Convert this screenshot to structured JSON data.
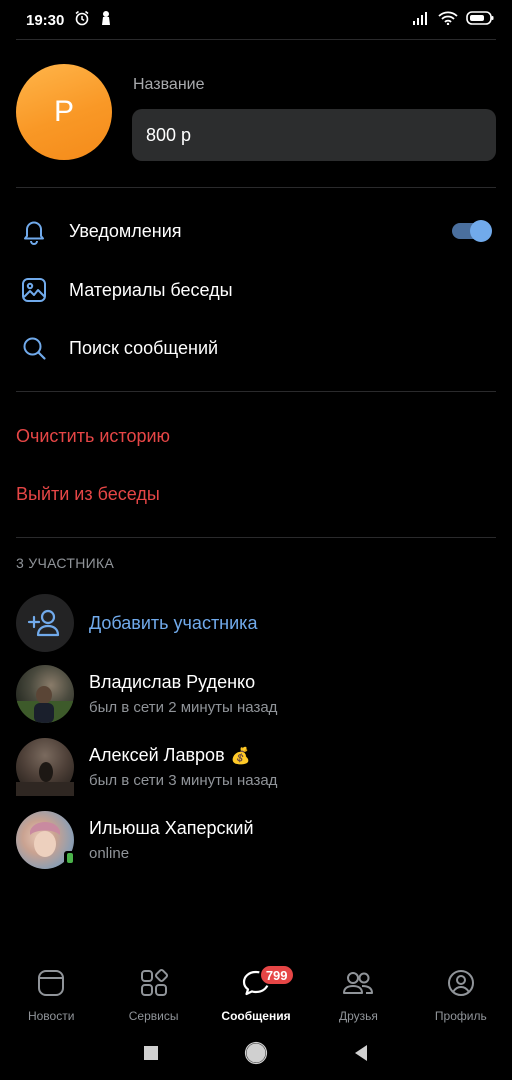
{
  "status_bar": {
    "time": "19:30"
  },
  "chat": {
    "avatar_letter": "Р",
    "name_label": "Название",
    "name_value": "800 р"
  },
  "menu": {
    "notifications": "Уведомления",
    "notifications_enabled": true,
    "materials": "Материалы беседы",
    "search": "Поиск сообщений"
  },
  "actions": {
    "clear_history": "Очистить историю",
    "leave": "Выйти из беседы"
  },
  "members": {
    "section_title": "3 УЧАСТНИКА",
    "add_label": "Добавить участника",
    "list": [
      {
        "name": "Владислав Руденко",
        "status": "был в сети 2 минуты назад",
        "emoji": ""
      },
      {
        "name": "Алексей Лавров",
        "status": "был в сети 3 минуты назад",
        "emoji": "💰"
      },
      {
        "name": "Ильюша Хаперский",
        "status": "online",
        "emoji": ""
      }
    ]
  },
  "tabbar": {
    "tabs": [
      {
        "label": "Новости",
        "icon": "newspaper-icon"
      },
      {
        "label": "Сервисы",
        "icon": "services-icon"
      },
      {
        "label": "Сообщения",
        "icon": "message-icon",
        "active": true,
        "badge": "799"
      },
      {
        "label": "Друзья",
        "icon": "friends-icon"
      },
      {
        "label": "Профиль",
        "icon": "profile-icon"
      }
    ]
  },
  "colors": {
    "accent": "#71aaeb",
    "danger": "#e64646",
    "avatar": "#f99826",
    "background": "#000000"
  }
}
